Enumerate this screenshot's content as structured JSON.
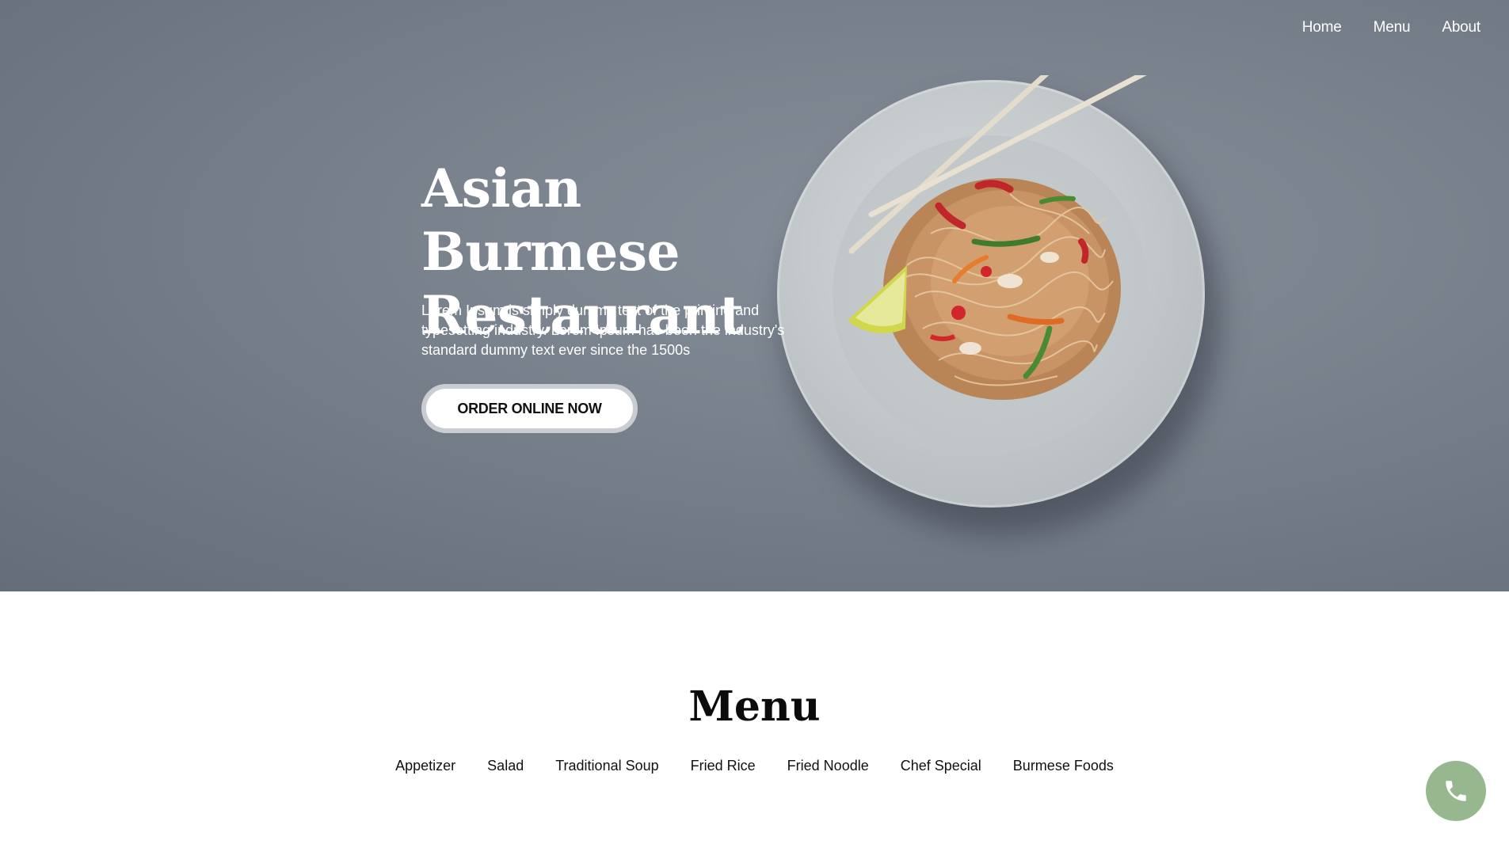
{
  "nav": {
    "items": [
      {
        "label": "Home"
      },
      {
        "label": "Menu"
      },
      {
        "label": "About"
      }
    ]
  },
  "hero": {
    "title": "Asian Burmese Restaurant",
    "description": "Lorem Ipsum is simply dummy text of the printing and typesetting industry. Lorem Ipsum has been the industry's standard dummy text ever since the 1500s",
    "cta_label": "ORDER ONLINE NOW",
    "image": "noodle-plate-image"
  },
  "menu": {
    "title": "Menu",
    "categories": [
      "Appetizer",
      "Salad",
      "Traditional Soup",
      "Fried Rice",
      "Fried Noodle",
      "Chef Special",
      "Burmese Foods"
    ]
  },
  "floating": {
    "phone_icon": "phone-icon",
    "color": "#97b78f"
  }
}
